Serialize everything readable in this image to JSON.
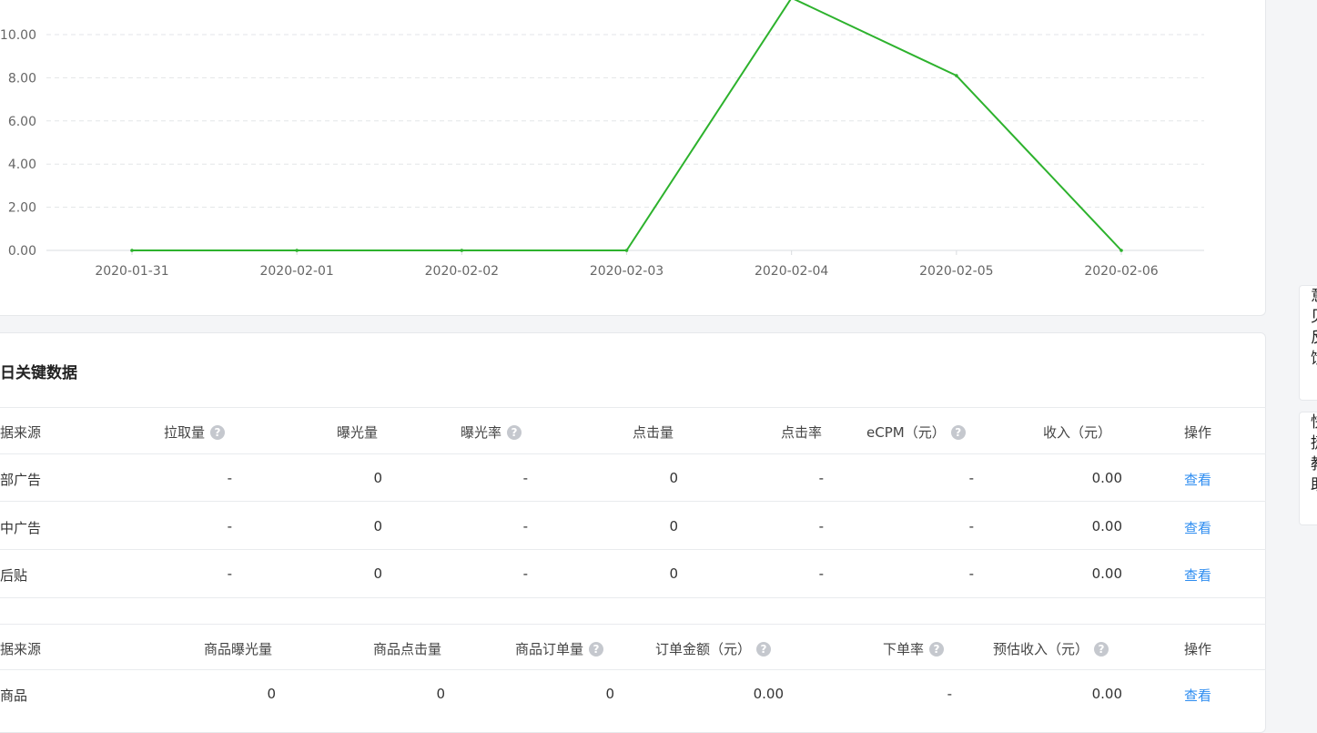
{
  "chart_data": {
    "type": "line",
    "x": [
      "2020-01-31",
      "2020-02-01",
      "2020-02-02",
      "2020-02-03",
      "2020-02-04",
      "2020-02-05",
      "2020-02-06"
    ],
    "series": [
      {
        "values": [
          0,
          0,
          0,
          0,
          11.7,
          8.1,
          0
        ],
        "color": "#2db22d"
      }
    ],
    "yticks": [
      "0.00",
      "2.00",
      "4.00",
      "6.00",
      "8.00",
      "10.00"
    ],
    "ylim": [
      0,
      12
    ],
    "grid": true
  },
  "key_data": {
    "title": "日关键数据",
    "ad_table": {
      "headers": {
        "source": "据来源",
        "pull": "拉取量",
        "exposure": "曝光量",
        "exposure_rate": "曝光率",
        "clicks": "点击量",
        "click_rate": "点击率",
        "ecpm": "eCPM（元）",
        "revenue": "收入（元）",
        "action": "操作"
      },
      "rows": [
        {
          "source": "部广告",
          "pull": "-",
          "exposure": "0",
          "exposure_rate": "-",
          "clicks": "0",
          "click_rate": "-",
          "ecpm": "-",
          "revenue": "0.00",
          "action": "查看"
        },
        {
          "source": "中广告",
          "pull": "-",
          "exposure": "0",
          "exposure_rate": "-",
          "clicks": "0",
          "click_rate": "-",
          "ecpm": "-",
          "revenue": "0.00",
          "action": "查看"
        },
        {
          "source": "后贴",
          "pull": "-",
          "exposure": "0",
          "exposure_rate": "-",
          "clicks": "0",
          "click_rate": "-",
          "ecpm": "-",
          "revenue": "0.00",
          "action": "查看"
        }
      ]
    },
    "goods_table": {
      "headers": {
        "source": "据来源",
        "goods_exposure": "商品曝光量",
        "goods_clicks": "商品点击量",
        "goods_orders": "商品订单量",
        "order_amount": "订单金额（元）",
        "order_rate": "下单率",
        "est_revenue": "预估收入（元）",
        "action": "操作"
      },
      "rows": [
        {
          "source": "商品",
          "goods_exposure": "0",
          "goods_clicks": "0",
          "goods_orders": "0",
          "order_amount": "0.00",
          "order_rate": "-",
          "est_revenue": "0.00",
          "action": "查看"
        }
      ]
    },
    "help_glyph": "?"
  },
  "side_panels": [
    {
      "text": "意见反馈"
    },
    {
      "text": "快捷教助"
    }
  ]
}
